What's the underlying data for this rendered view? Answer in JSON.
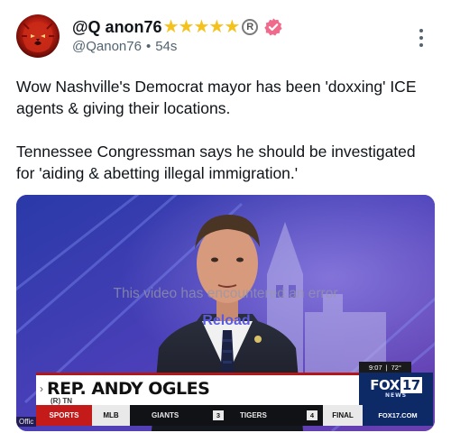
{
  "post": {
    "display_name": "@Q anon76",
    "name_suffix_stars": [
      "★",
      "★",
      "★",
      "★",
      "★"
    ],
    "registered_mark": "R",
    "handle": "@Qanon76",
    "separator": "•",
    "time_ago": "54s",
    "paragraphs": [
      "Wow Nashville's Democrat mayor has been 'doxxing' ICE agents & giving their locations.",
      "Tennessee Congressman says he should be investigated for 'aiding & abetting illegal immigration.'"
    ]
  },
  "icons": {
    "verified": "verified-badge-icon",
    "more": "more-options-icon",
    "star": "star-icon"
  },
  "media": {
    "error_text": "This video has encountered an error",
    "reload_label": "Reload",
    "lower_third": {
      "name": "REP. ANDY OGLES",
      "subtitle": "(R) TN",
      "chevron": "›",
      "time": "9:07",
      "divider": "|",
      "temperature": "72°",
      "station_prefix": "FOX",
      "station_number": "17",
      "station_sub": "NEWS"
    },
    "ticker": {
      "section": "SPORTS",
      "league": "MLB",
      "team1": "GIANTS",
      "score1": "3",
      "team2": "TIGERS",
      "score2": "4",
      "status": "FINAL",
      "site": "FOX17.COM"
    },
    "corner_tag": "Offic"
  },
  "colors": {
    "verified_badge": "#f06a8c",
    "star": "#f5c21b",
    "reload": "#5a5ae0",
    "accent_red": "#c41a1a",
    "fox_blue": "#0e2a66"
  }
}
